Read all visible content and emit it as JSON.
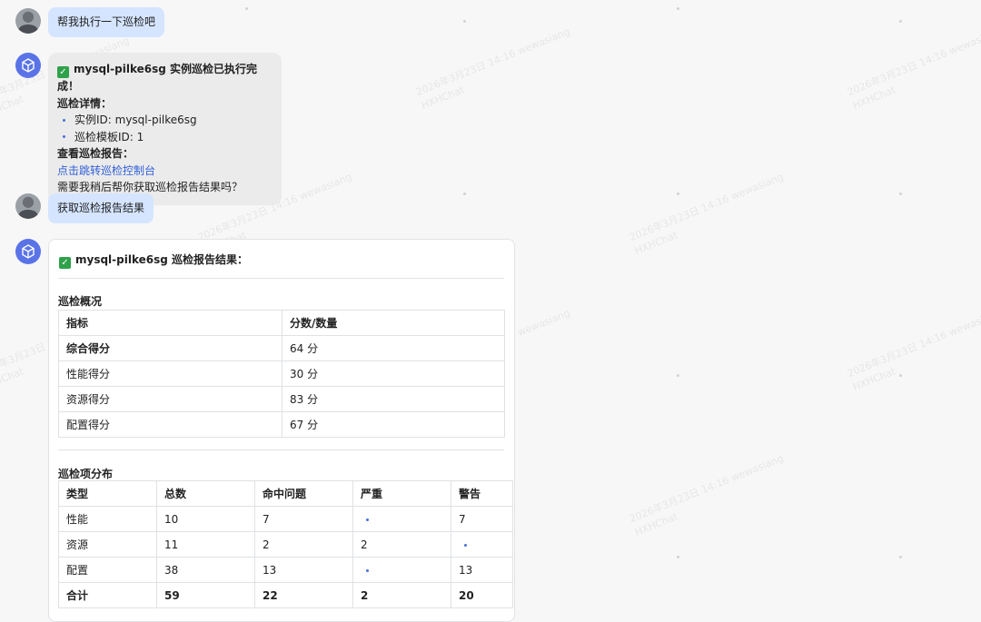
{
  "watermark": {
    "lines": [
      "2026年3月23日 14:16 wewasiang",
      "HXHChat"
    ]
  },
  "messages": {
    "user1": "帮我执行一下巡检吧",
    "bot1": {
      "title_id": "mysql-pilke6sg",
      "title_rest": " 实例巡检已执行完成！",
      "details_label": "巡检详情：",
      "details": [
        "实例ID: mysql-pilke6sg",
        "巡检模板ID: 1"
      ],
      "report_label": "查看巡检报告：",
      "report_link": "点击跳转巡检控制台",
      "followup": "需要我稍后帮你获取巡检报告结果吗？"
    },
    "user2": "获取巡检报告结果",
    "bot2": {
      "title_id": "mysql-pilke6sg",
      "title_rest": " 巡检报告结果：",
      "overview": {
        "title": "巡检概况",
        "headers": [
          "指标",
          "分数/数量"
        ],
        "rows": [
          [
            "综合得分",
            "64 分"
          ],
          [
            "性能得分",
            "30 分"
          ],
          [
            "资源得分",
            "83 分"
          ],
          [
            "配置得分",
            "67 分"
          ]
        ]
      },
      "distribution": {
        "title": "巡检项分布",
        "headers": [
          "类型",
          "总数",
          "命中问题",
          "严重",
          "警告"
        ],
        "rows": [
          [
            "性能",
            "10",
            "7",
            "",
            "7"
          ],
          [
            "资源",
            "11",
            "2",
            "2",
            ""
          ],
          [
            "配置",
            "38",
            "13",
            "",
            "13"
          ],
          [
            "合计",
            "59",
            "22",
            "2",
            "20"
          ]
        ]
      }
    }
  },
  "icons": {
    "check": "check-mark-icon",
    "bot": "cube-icon",
    "user": "user-photo"
  },
  "colors": {
    "user_bubble": "#d5e5ff",
    "bot_bubble": "#ebebeb",
    "link": "#2f5fd8",
    "check": "#2fa14a"
  }
}
